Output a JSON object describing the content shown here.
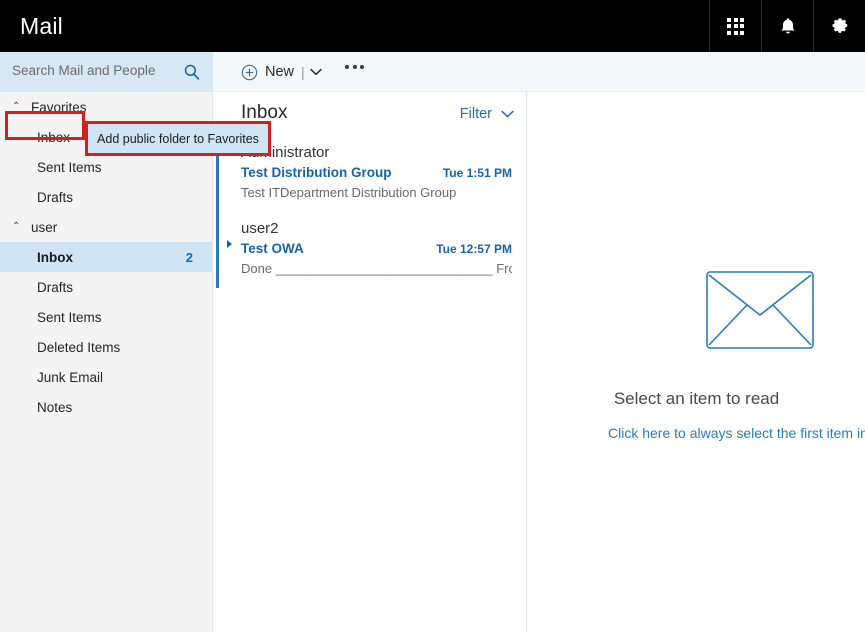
{
  "suitebar": {
    "app_title": "Mail",
    "icons": [
      {
        "name": "app-launcher-icon",
        "label": "App launcher"
      },
      {
        "name": "notifications-bell-icon",
        "label": "Notifications"
      },
      {
        "name": "settings-gear-icon",
        "label": "Settings"
      }
    ]
  },
  "search": {
    "placeholder": "Search Mail and People",
    "value": "",
    "icon": "search-icon"
  },
  "toolbar": {
    "new_label": "New",
    "new_separator": "|",
    "new_caret": "⌄",
    "more_label": "•••"
  },
  "sidebar": {
    "groups": [
      {
        "name": "favorites",
        "label": "Favorites",
        "chevron": "⌃",
        "items": [
          {
            "label": "Inbox",
            "count": "",
            "selected": false
          },
          {
            "label": "Sent Items",
            "count": "",
            "selected": false
          },
          {
            "label": "Drafts",
            "count": "",
            "selected": false
          }
        ]
      },
      {
        "name": "user",
        "label": "user",
        "chevron": "⌃",
        "items": [
          {
            "label": "Inbox",
            "count": "2",
            "selected": true
          },
          {
            "label": "Drafts",
            "count": "",
            "selected": false
          },
          {
            "label": "Sent Items",
            "count": "",
            "selected": false
          },
          {
            "label": "Deleted Items",
            "count": "",
            "selected": false
          },
          {
            "label": "Junk Email",
            "count": "",
            "selected": false
          },
          {
            "label": "Notes",
            "count": "",
            "selected": false
          }
        ]
      }
    ]
  },
  "message_list": {
    "title": "Inbox",
    "filter_label": "Filter",
    "filter_caret": "⌄",
    "messages": [
      {
        "from": "Administrator",
        "subject": "Test Distribution Group",
        "time": "Tue 1:51 PM",
        "preview": "Test ITDepartment Distribution Group",
        "unread": true,
        "expandable": false
      },
      {
        "from": "user2",
        "subject": "Test OWA",
        "time": "Tue 12:57 PM",
        "preview": "Done ______________________________ From:...",
        "unread": true,
        "expandable": true
      }
    ]
  },
  "reading_pane": {
    "envelope_icon": "envelope-icon",
    "empty_title": "Select an item to read",
    "empty_link": "Click here to always select the first item in the list"
  },
  "annotations": {
    "tooltip_text": "Add public folder to Favorites",
    "highlight_color": "#d41f1f",
    "tooltip_bg": "#cfe4f5",
    "highlights": [
      {
        "name": "favorites-highlight",
        "target": "Favorites"
      },
      {
        "name": "tooltip-highlight",
        "target": "Add public folder to Favorites"
      }
    ]
  },
  "colors": {
    "suitebar_bg": "#000000",
    "search_bg": "#d7e8f5",
    "command_bg": "#f3f8fb",
    "sidebar_bg": "#f4f4f4",
    "selection_bg": "#cfe4f5",
    "link_blue": "#1565a5",
    "accent_blue": "#2b7cb8"
  }
}
